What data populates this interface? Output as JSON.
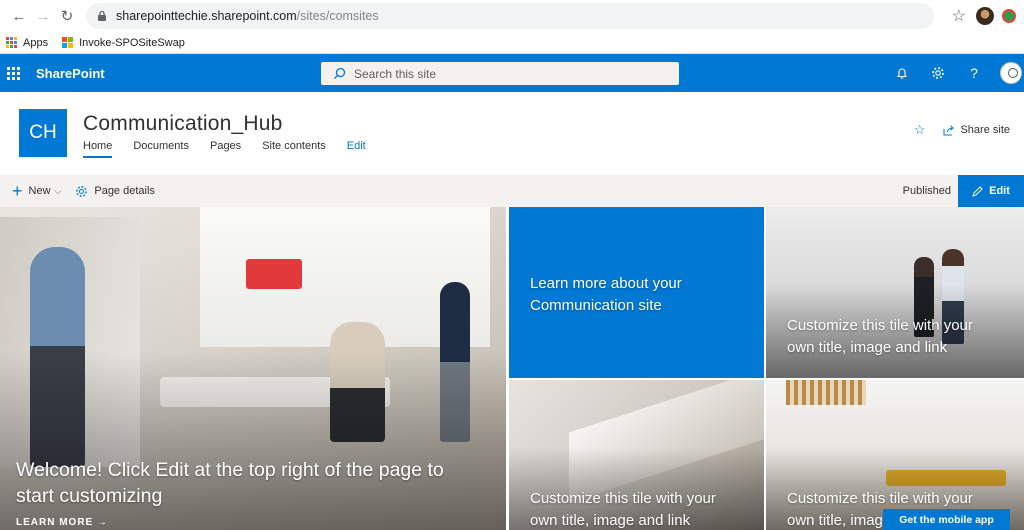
{
  "browser": {
    "url_host": "sharepointtechie.sharepoint.com",
    "url_path": "/sites/comsites",
    "bookmarks": [
      {
        "label": "Apps",
        "icon": "apps-grid-icon"
      },
      {
        "label": "Invoke-SPOSiteSwap",
        "icon": "microsoft-logo-icon"
      }
    ]
  },
  "suitebar": {
    "brand": "SharePoint",
    "search_placeholder": "Search this site",
    "color": "#0078d4"
  },
  "site": {
    "logo_initials": "CH",
    "title": "Communication_Hub",
    "nav": [
      {
        "label": "Home",
        "active": true
      },
      {
        "label": "Documents"
      },
      {
        "label": "Pages"
      },
      {
        "label": "Site contents"
      },
      {
        "label": "Edit"
      }
    ],
    "share_label": "Share site"
  },
  "commandbar": {
    "new_label": "New",
    "page_details_label": "Page details",
    "status": "Published",
    "edit_label": "Edit"
  },
  "hero": {
    "main_caption": "Welcome! Click Edit at the top right of the page to start customizing",
    "learn_more": "LEARN MORE →",
    "blue_tile": "Learn more about your Communication site",
    "tile_top_right": "Customize this tile with your own title, image and link",
    "tile_bottom_middle": "Customize this tile with your own title, image and link",
    "tile_bottom_right": "Customize this tile with your own title, image and link"
  },
  "mobile_button": "Get the mobile app"
}
